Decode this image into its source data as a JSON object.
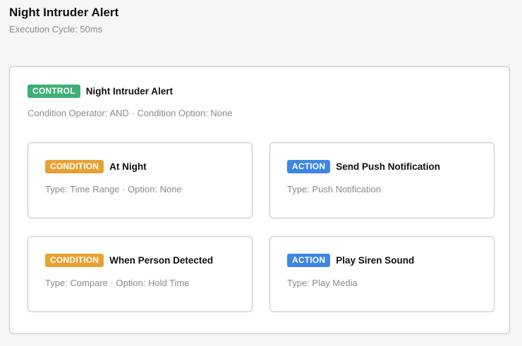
{
  "header": {
    "title": "Night Intruder Alert",
    "subtitle": "Execution Cycle: 50ms"
  },
  "control": {
    "badge": "CONTROL",
    "title": "Night Intruder Alert",
    "meta": "Condition Operator: AND · Condition Option: None"
  },
  "cards": [
    {
      "badge": "CONDITION",
      "title": "At Night",
      "meta": "Type: Time Range · Option: None"
    },
    {
      "badge": "ACTION",
      "title": "Send Push Notification",
      "meta": "Type: Push Notification"
    },
    {
      "badge": "CONDITION",
      "title": "When Person Detected",
      "meta": "Type: Compare · Option: Hold Time"
    },
    {
      "badge": "ACTION",
      "title": "Play Siren Sound",
      "meta": "Type: Play Media"
    }
  ],
  "colors": {
    "control_badge": "#3fae76",
    "condition_badge": "#e9a032",
    "action_badge": "#3d86e4"
  }
}
